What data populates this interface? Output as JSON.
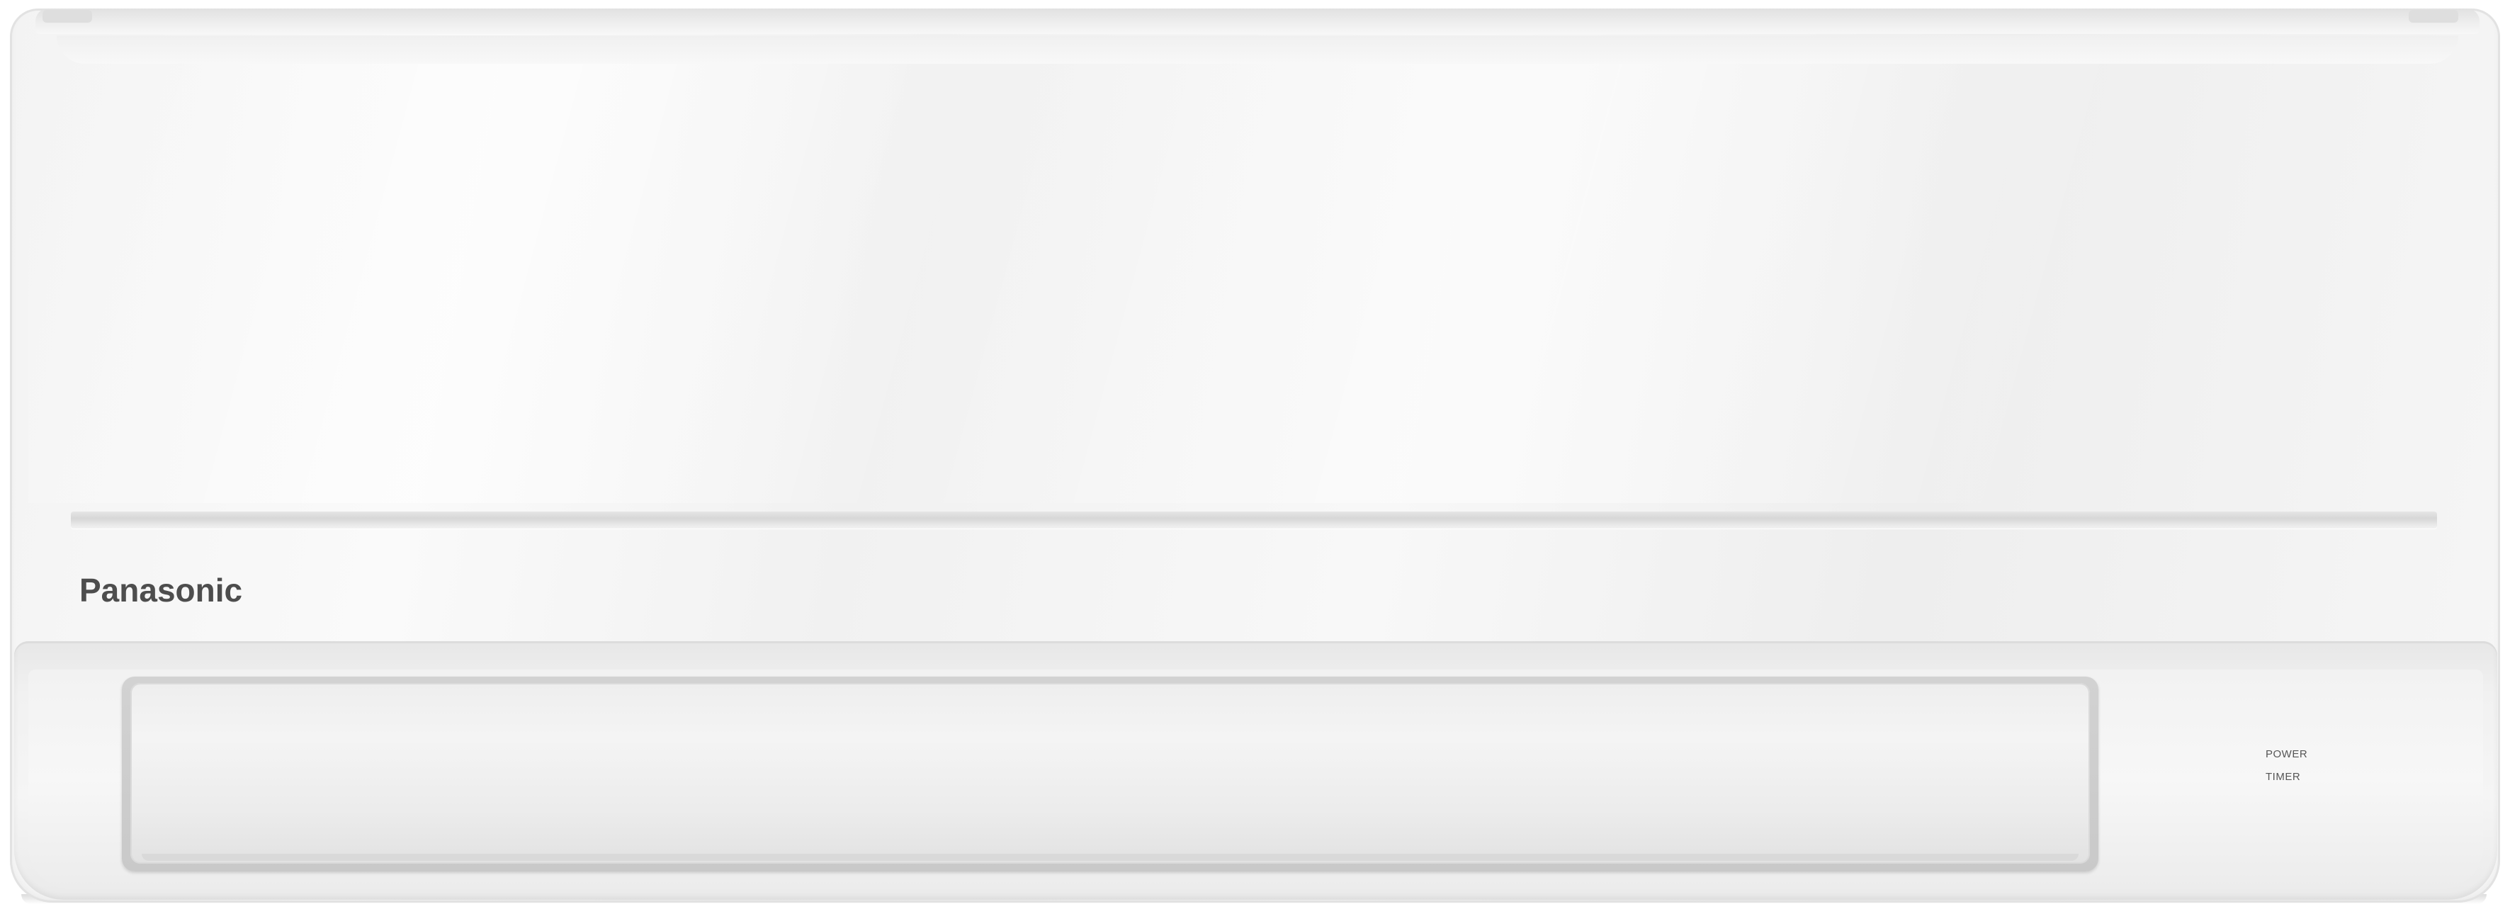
{
  "image": {
    "subject": "wall-mounted air conditioner indoor unit"
  },
  "brand": {
    "logo_text": "Panasonic",
    "logo_color": "#4d4d4d"
  },
  "indicators": {
    "power_label": "POWER",
    "timer_label": "TIMER"
  },
  "colors": {
    "body": "#f4f4f4",
    "accent_line": "#d7d7d7",
    "vent_frame": "#c9c9c9"
  }
}
